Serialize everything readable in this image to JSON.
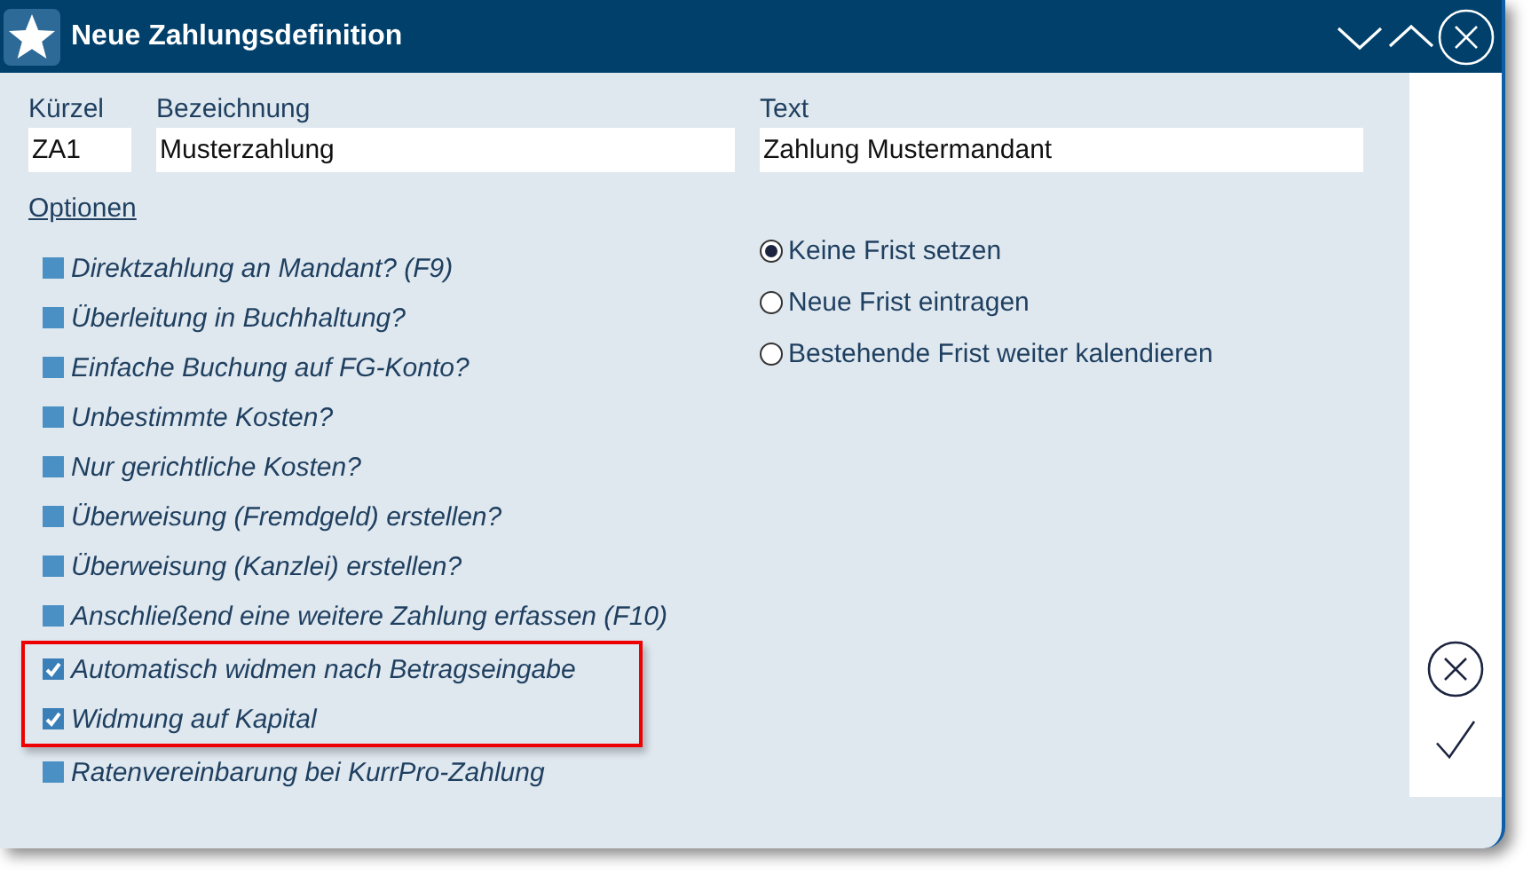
{
  "window": {
    "title": "Neue Zahlungsdefinition"
  },
  "fields": [
    {
      "label": "Kürzel",
      "value": "ZA1",
      "kind": "short"
    },
    {
      "label": "Bezeichnung",
      "value": "Musterzahlung",
      "kind": "medium"
    },
    {
      "label": "Text",
      "value": "Zahlung Mustermandant",
      "kind": "wide"
    }
  ],
  "options_heading": "Optionen",
  "options": [
    {
      "label": "Direktzahlung an Mandant? (F9)",
      "checked": false,
      "highlighted": false
    },
    {
      "label": "Überleitung in Buchhaltung?",
      "checked": false,
      "highlighted": false
    },
    {
      "label": "Einfache Buchung auf FG-Konto?",
      "checked": false,
      "highlighted": false
    },
    {
      "label": "Unbestimmte Kosten?",
      "checked": false,
      "highlighted": false
    },
    {
      "label": "Nur gerichtliche Kosten?",
      "checked": false,
      "highlighted": false
    },
    {
      "label": "Überweisung (Fremdgeld) erstellen?",
      "checked": false,
      "highlighted": false
    },
    {
      "label": "Überweisung (Kanzlei) erstellen?",
      "checked": false,
      "highlighted": false
    },
    {
      "label": "Anschließend eine weitere Zahlung erfassen (F10)",
      "checked": false,
      "highlighted": false
    },
    {
      "label": "Automatisch widmen nach Betragseingabe",
      "checked": true,
      "highlighted": true
    },
    {
      "label": "Widmung auf Kapital",
      "checked": true,
      "highlighted": true
    },
    {
      "label": "Ratenvereinbarung bei KurrPro-Zahlung",
      "checked": false,
      "highlighted": false
    }
  ],
  "deadline": [
    {
      "label": "Keine Frist setzen",
      "selected": true
    },
    {
      "label": "Neue Frist eintragen",
      "selected": false
    },
    {
      "label": "Bestehende Frist weiter kalendieren",
      "selected": false
    }
  ]
}
